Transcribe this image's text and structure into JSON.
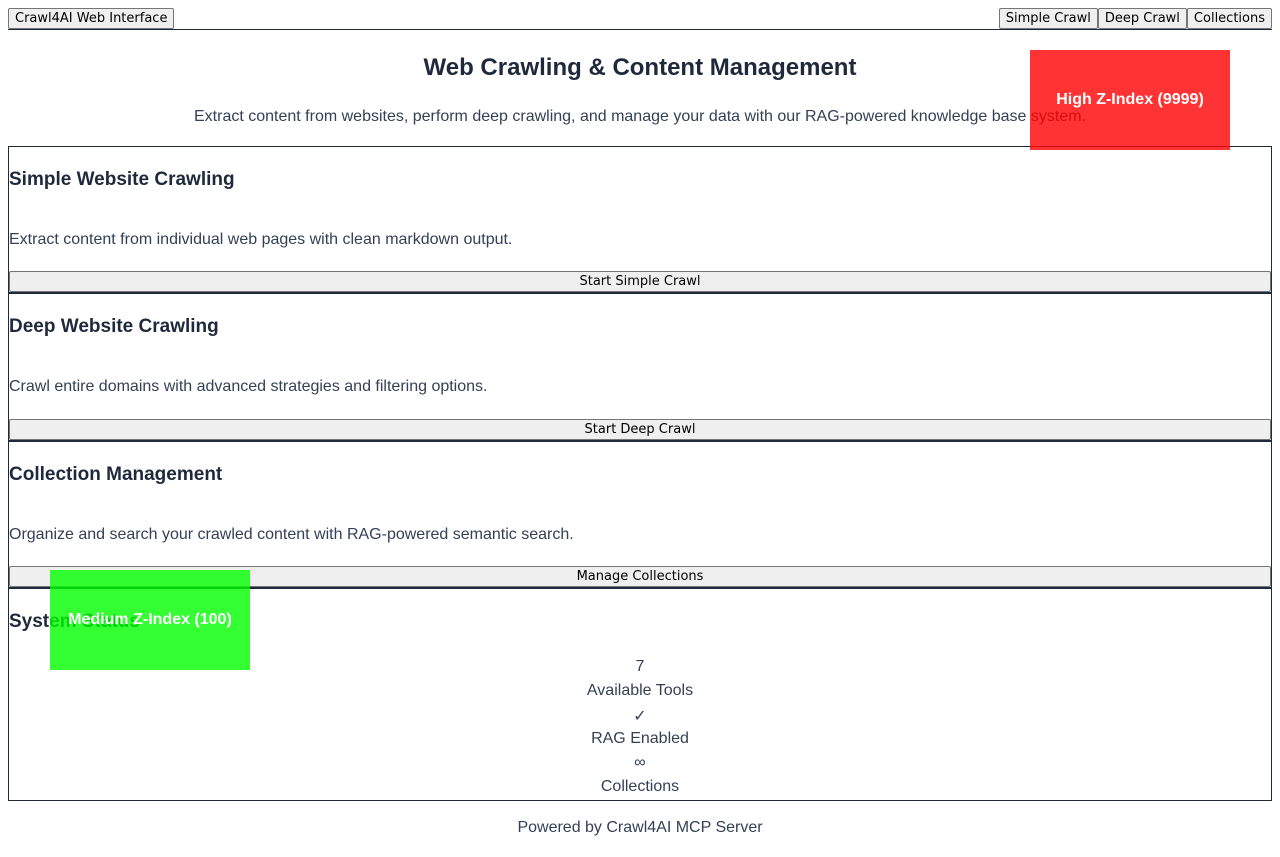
{
  "nav": {
    "brand_label": "Crawl4AI Web Interface",
    "links": [
      "Simple Crawl",
      "Deep Crawl",
      "Collections"
    ]
  },
  "hero": {
    "title": "Web Crawling & Content Management",
    "subtitle": "Extract content from websites, perform deep crawling, and manage your data with our RAG-powered knowledge base system."
  },
  "cards": [
    {
      "title": "Simple Website Crawling",
      "description": "Extract content from individual web pages with clean markdown output.",
      "button": "Start Simple Crawl"
    },
    {
      "title": "Deep Website Crawling",
      "description": "Crawl entire domains with advanced strategies and filtering options.",
      "button": "Start Deep Crawl"
    },
    {
      "title": "Collection Management",
      "description": "Organize and search your crawled content with RAG-powered semantic search.",
      "button": "Manage Collections"
    }
  ],
  "status": {
    "title": "System Status",
    "stats": [
      {
        "value": "7",
        "label": "Available Tools"
      },
      {
        "value": "✓",
        "label": "RAG Enabled"
      },
      {
        "value": "∞",
        "label": "Collections"
      }
    ]
  },
  "footer": {
    "text": "Powered by Crawl4AI MCP Server"
  },
  "overlays": {
    "high": "High Z-Index (9999)",
    "medium": "Medium Z-Index (100)"
  }
}
